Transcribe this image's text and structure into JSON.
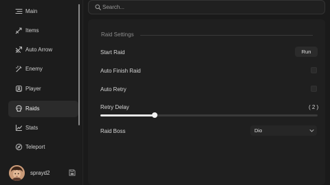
{
  "search": {
    "placeholder": "Search..."
  },
  "sidebar": {
    "items": [
      {
        "label": "Main",
        "icon": "list-icon",
        "active": false
      },
      {
        "label": "Items",
        "icon": "sword-icon",
        "active": false
      },
      {
        "label": "Auto Arrow",
        "icon": "arrow-icon",
        "active": false
      },
      {
        "label": "Enemy",
        "icon": "wand-icon",
        "active": false
      },
      {
        "label": "Player",
        "icon": "person-icon",
        "active": false
      },
      {
        "label": "Raids",
        "icon": "skull-icon",
        "active": true
      },
      {
        "label": "Stats",
        "icon": "chart-icon",
        "active": false
      },
      {
        "label": "Teleport",
        "icon": "compass-icon",
        "active": false
      }
    ],
    "profile": {
      "username": "sprayd2"
    }
  },
  "raid": {
    "section_title": "Raid Settings",
    "start_raid": {
      "label": "Start Raid",
      "button": "Run"
    },
    "auto_finish": {
      "label": "Auto Finish Raid",
      "checked": false
    },
    "auto_retry": {
      "label": "Auto Retry",
      "checked": false
    },
    "retry_delay": {
      "label": "Retry Delay",
      "display": "( 2 )",
      "fraction": 0.25
    },
    "raid_boss": {
      "label": "Raid Boss",
      "value": "Dio"
    }
  }
}
